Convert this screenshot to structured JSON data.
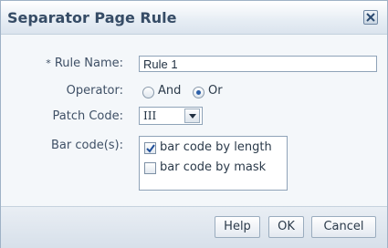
{
  "dialog": {
    "title": "Separator Page Rule",
    "close_icon": "close-icon"
  },
  "form": {
    "rule_name": {
      "required_mark": "*",
      "label": "Rule Name:",
      "value": "Rule 1"
    },
    "operator": {
      "label": "Operator:",
      "options": [
        {
          "label": "And",
          "selected": false
        },
        {
          "label": "Or",
          "selected": true
        }
      ]
    },
    "patch_code": {
      "label": "Patch Code:",
      "value": "III",
      "dropdown_icon": "chevron-down-icon"
    },
    "bar_codes": {
      "label": "Bar code(s):",
      "items": [
        {
          "label": "bar code by length",
          "checked": true
        },
        {
          "label": "bar code by mask",
          "checked": false
        }
      ]
    }
  },
  "buttons": {
    "help": "Help",
    "ok": "OK",
    "cancel": "Cancel"
  },
  "colors": {
    "title": "#364c66",
    "accent": "#2b5fa8",
    "border": "#8fa3b8"
  }
}
